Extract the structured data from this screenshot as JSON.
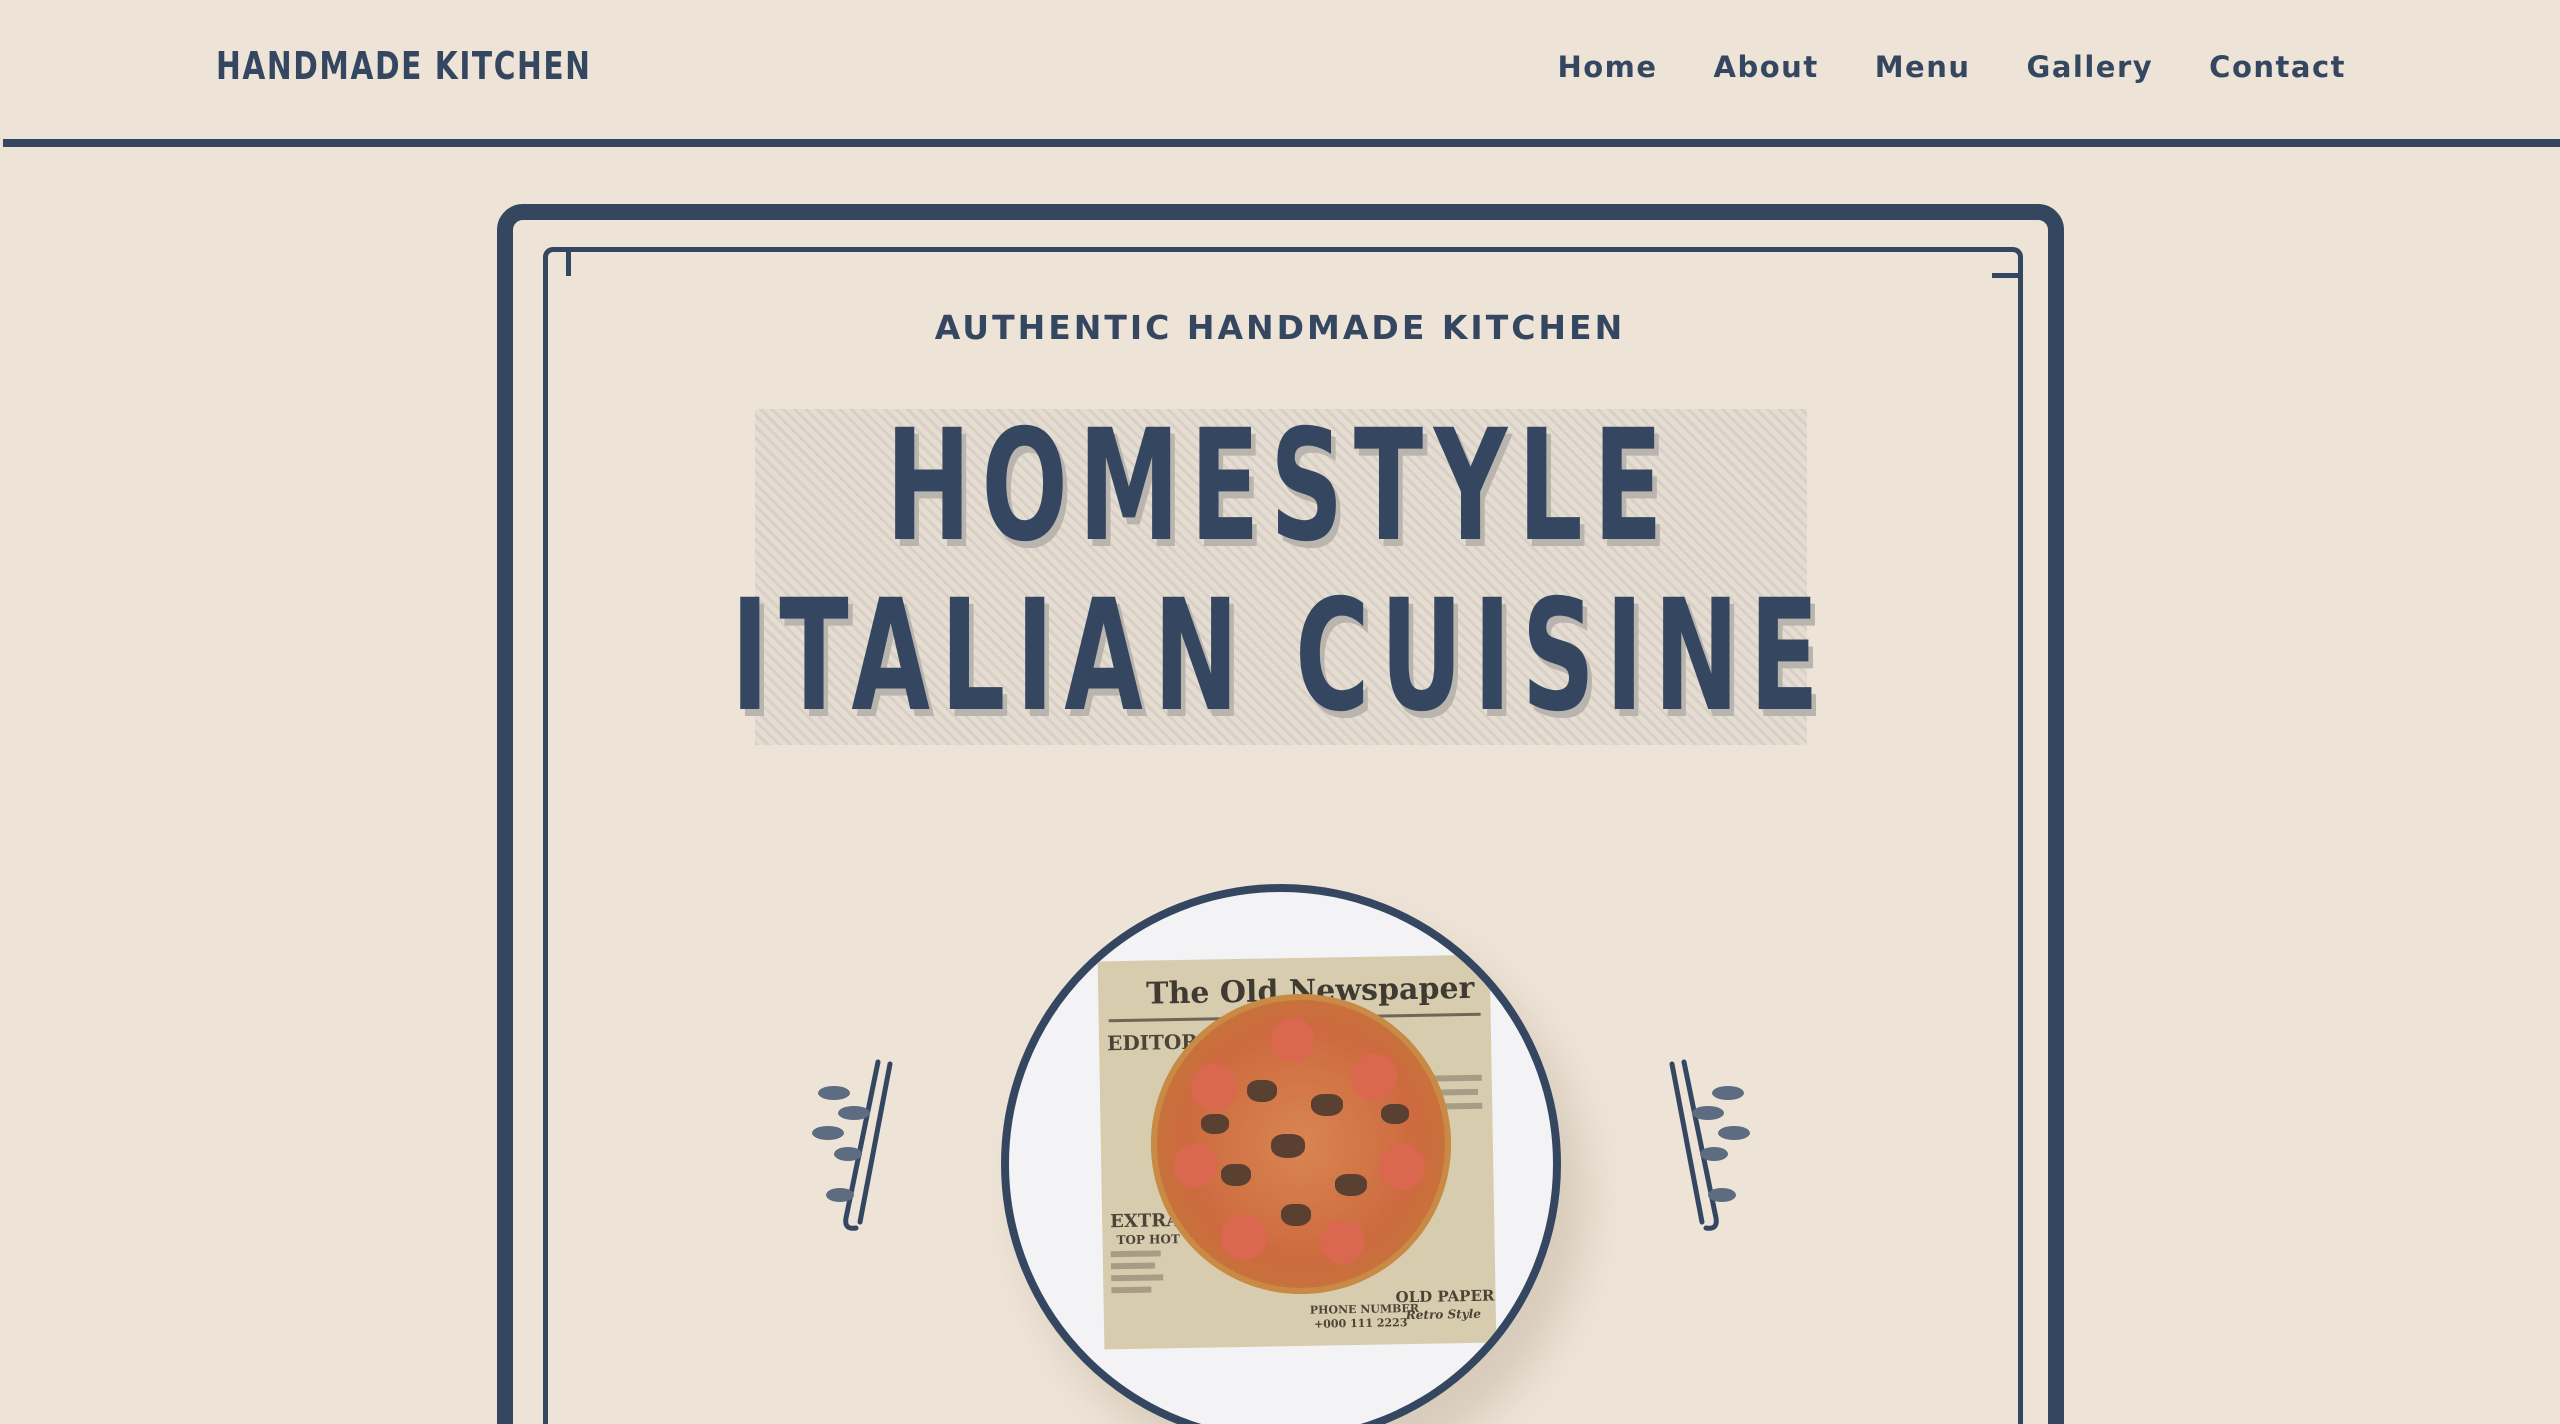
{
  "brand": "HANDMADE KITCHEN",
  "nav": [
    "Home",
    "About",
    "Menu",
    "Gallery",
    "Contact"
  ],
  "hero": {
    "eyebrow": "AUTHENTIC HANDMADE KITCHEN",
    "title_line1": "HOMESTYLE",
    "title_line2": "ITALIAN CUISINE"
  },
  "plate": {
    "newspaper_title": "The Old Newspaper",
    "newspaper_labels": [
      "EDITOR",
      "EXTRA",
      "TOP HOT",
      "PHONE NUMBER",
      "+000 111 2223",
      "OLD PAPER",
      "Retro Style"
    ]
  },
  "colors": {
    "background": "#ede3d6",
    "accent": "#354760"
  },
  "icons": [
    "chopsticks-left-icon",
    "chopsticks-right-icon"
  ]
}
